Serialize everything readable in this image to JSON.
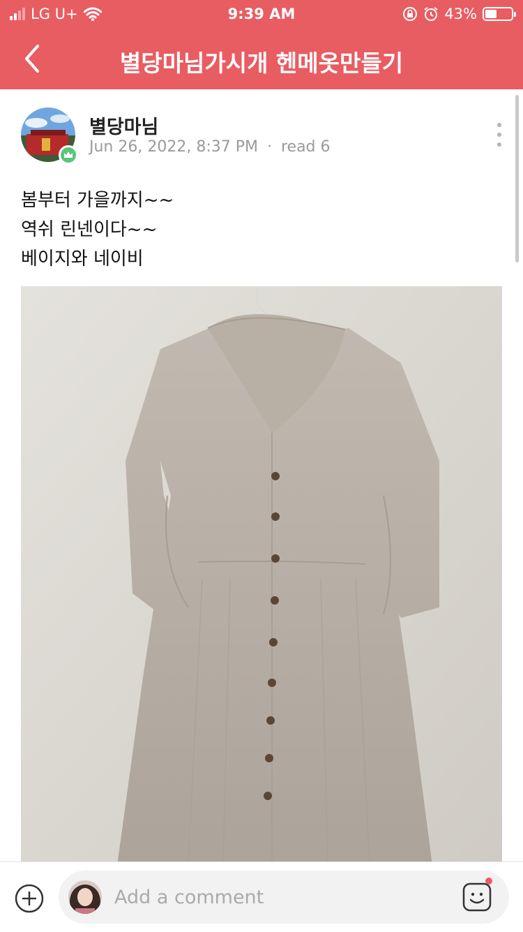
{
  "status_bar": {
    "carrier": "LG U+",
    "time": "9:39 AM",
    "battery": "43%"
  },
  "header": {
    "title": "별당마님가시개 헨메옷만들기",
    "back_icon": "chevron-left-icon"
  },
  "post": {
    "author": "별당마님",
    "date": "Jun 26, 2022, 8:37 PM",
    "separator": "·",
    "read": "read 6",
    "lines": [
      "봄부터 가을까지~~",
      "역쉬 린넨이다~~",
      "베이지와 네이비"
    ]
  },
  "comment_bar": {
    "placeholder": "Add a comment"
  },
  "colors": {
    "accent": "#e85d62",
    "online_badge": "#5bc47a"
  }
}
